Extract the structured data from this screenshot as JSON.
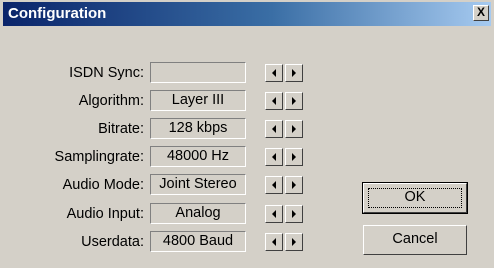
{
  "window": {
    "title": "Configuration",
    "close_glyph": "X"
  },
  "rows": [
    {
      "label": "ISDN Sync:",
      "value": ""
    },
    {
      "label": "Algorithm:",
      "value": "Layer III"
    },
    {
      "label": "Bitrate:",
      "value": "128 kbps"
    },
    {
      "label": "Samplingrate:",
      "value": "48000 Hz"
    },
    {
      "label": "Audio Mode:",
      "value": "Joint Stereo"
    },
    {
      "label": "Audio Input:",
      "value": "Analog"
    },
    {
      "label": "Userdata:",
      "value": "4800 Baud"
    }
  ],
  "buttons": {
    "ok_label": "OK",
    "cancel_label": "Cancel"
  },
  "icons": {
    "spin_left": "arrow-left-icon",
    "spin_right": "arrow-right-icon",
    "close": "close-icon"
  }
}
